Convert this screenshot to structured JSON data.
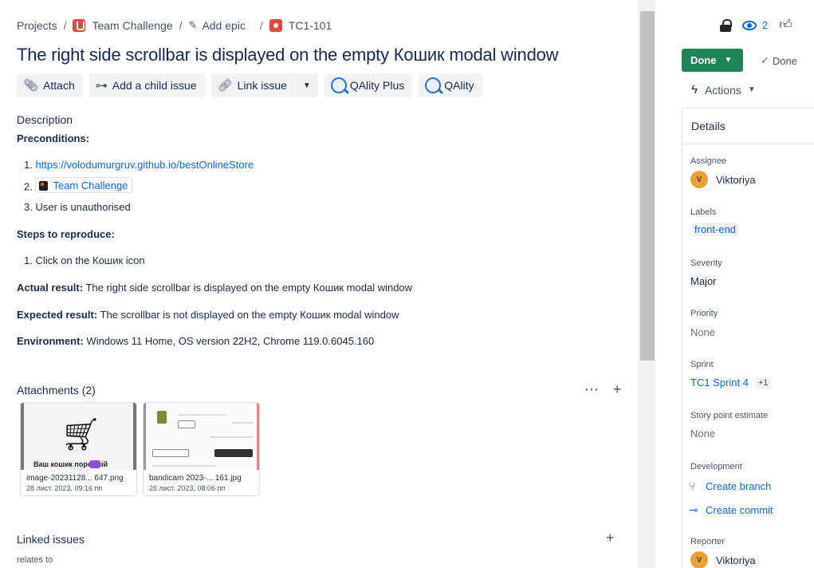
{
  "breadcrumb": {
    "projects": "Projects",
    "project": "Team Challenge",
    "epic": "Add epic",
    "issue_key": "TC1-101",
    "separator": "/"
  },
  "issue": {
    "title": "The right side scrollbar is displayed on the empty Кошик modal window"
  },
  "toolbar": {
    "attach": "Attach",
    "add_child": "Add a child issue",
    "link_issue": "Link issue",
    "qality_plus": "QAlity Plus",
    "qality": "QAlity"
  },
  "description": {
    "label": "Description",
    "preconditions_label": "Preconditions:",
    "preconditions": [
      "https://volodumurgruv.github.io/bestOnlineStore",
      "Team Challenge",
      "User is unauthorised"
    ],
    "steps_label": "Steps to reproduce:",
    "steps": [
      "Click on the Кошик icon"
    ],
    "actual_label": "Actual result:",
    "actual": "The right side scrollbar is displayed on the empty Кошик modal window",
    "expected_label": "Expected result:",
    "expected": "The scrollbar is not displayed on the empty Кошик modal window",
    "environment_label": "Environment:",
    "environment": "Windows 11 Home, OS version 22H2, Chrome 119.0.6045.160"
  },
  "attachments": {
    "header": "Attachments (2)",
    "items": [
      {
        "name": "image-20231128... 647.png",
        "date": "28 лист. 2023, 09:16 пп",
        "thumb_text": "Ваш кошик порожній"
      },
      {
        "name": "bandicam 2023-... 161.jpg",
        "date": "26 лист. 2023, 08:06 пп"
      }
    ]
  },
  "linked_issues": {
    "header": "Linked issues",
    "relation": "relates to"
  },
  "sidebar": {
    "watchers": "2",
    "status_button": "Done",
    "resolution": "Done",
    "actions": "Actions",
    "details_title": "Details",
    "assignee_label": "Assignee",
    "assignee": "Viktoriya",
    "assignee_initial": "V",
    "labels_label": "Labels",
    "label_value": "front-end",
    "severity_label": "Severity",
    "severity": "Major",
    "priority_label": "Priority",
    "priority": "None",
    "sprint_label": "Sprint",
    "sprint": "TC1 Sprint 4",
    "sprint_more": "+1",
    "story_points_label": "Story point estimate",
    "story_points": "None",
    "development_label": "Development",
    "create_branch": "Create branch",
    "create_commit": "Create commit",
    "reporter_label": "Reporter",
    "reporter": "Viktoriya",
    "reporter_initial": "V"
  },
  "colors": {
    "done_green": "#1f845a",
    "link_blue": "#0c66e4",
    "text": "#172b4d",
    "avatar": "#e9a23b"
  }
}
